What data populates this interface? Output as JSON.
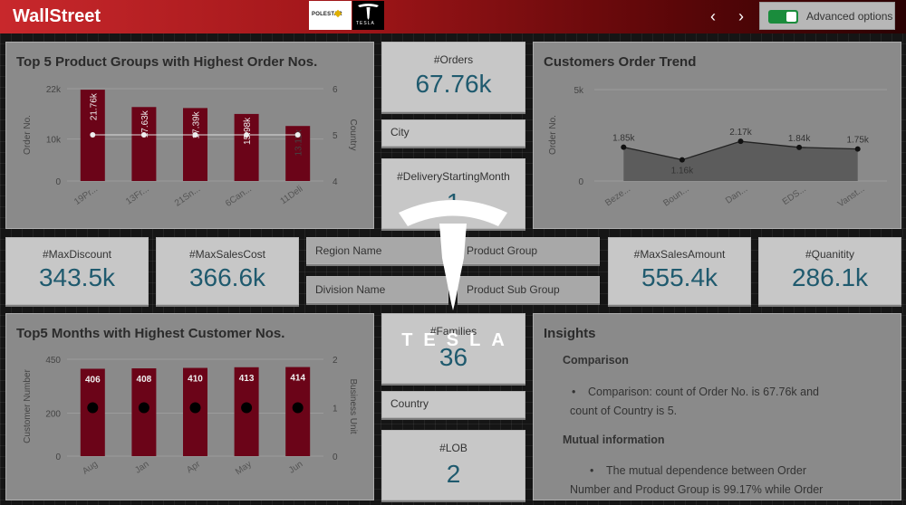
{
  "header": {
    "title": "WallStreet",
    "polestar_logo_text": "POLESTAR",
    "tesla_logo_text": "TESLA",
    "prev_icon": "chevron-left-icon",
    "next_icon": "chevron-right-icon",
    "advanced_label": "Advanced options",
    "toggle_on": true,
    "toggle_color": "#1a8c3c"
  },
  "kpis": {
    "orders": {
      "label": "#Orders",
      "value": "67.76k"
    },
    "delivery_month": {
      "label": "#DeliveryStartingMonth",
      "value": "1"
    },
    "max_discount": {
      "label": "#MaxDiscount",
      "value": "343.5k"
    },
    "max_sales_cost": {
      "label": "#MaxSalesCost",
      "value": "366.6k"
    },
    "max_sales_amount": {
      "label": "#MaxSalesAmount",
      "value": "555.4k"
    },
    "quantity": {
      "label": "#Quanitity",
      "value": "286.1k"
    },
    "families": {
      "label": "#Families",
      "value": "36"
    },
    "lob": {
      "label": "#LOB",
      "value": "2"
    }
  },
  "filters": {
    "city": "City",
    "region": "Region Name",
    "division": "Division Name",
    "product_group": "Product Group",
    "product_sub_group": "Product Sub Group",
    "country": "Country"
  },
  "watermark": {
    "text": "TESLA",
    "logo_icon": "tesla-logo-icon"
  },
  "colors": {
    "bar": "#6b0418",
    "accent": "#1f5a6e",
    "header_start": "#c8282c"
  },
  "chart_data": [
    {
      "id": "top_product_groups",
      "type": "bar",
      "title": "Top 5 Product Groups with Highest Order Nos.",
      "categories": [
        "19Pr...",
        "13Fr...",
        "21Sn...",
        "6Can...",
        "11Deli"
      ],
      "series": [
        {
          "name": "Order No.",
          "values": [
            21760,
            17630,
            17390,
            15980,
            13110
          ],
          "labels": [
            "21.76k",
            "17.63k",
            "17.39k",
            "15.98k",
            "13.11k"
          ],
          "axis": "left"
        },
        {
          "name": "Country",
          "values": [
            5,
            5,
            5,
            5,
            5
          ],
          "axis": "right",
          "style": "line"
        }
      ],
      "ylabel": "Order No.",
      "y2label": "Country",
      "ylim": [
        0,
        22000
      ],
      "y2lim": [
        4,
        6
      ],
      "yticks": [
        "0",
        "10k",
        "22k"
      ],
      "y2ticks": [
        "4",
        "5",
        "6"
      ]
    },
    {
      "id": "customer_order_trend",
      "type": "area",
      "title": "Customers Order Trend",
      "categories": [
        "Beze...",
        "Boun...",
        "Dan...",
        "EDS...",
        "Vanst..."
      ],
      "values": [
        1850,
        1160,
        2170,
        1840,
        1750
      ],
      "labels": [
        "1.85k",
        "1.16k",
        "2.17k",
        "1.84k",
        "1.75k"
      ],
      "ylabel": "Order No.",
      "ylim": [
        0,
        5000
      ],
      "yticks": [
        "0",
        "5k"
      ]
    },
    {
      "id": "top_months",
      "type": "bar",
      "title": "Top5 Months with Highest Customer Nos.",
      "categories": [
        "Aug",
        "Jan",
        "Apr",
        "May",
        "Jun"
      ],
      "series": [
        {
          "name": "Customer Number",
          "values": [
            406,
            408,
            410,
            413,
            414
          ],
          "axis": "left"
        },
        {
          "name": "Business Unit",
          "values": [
            1,
            1,
            1,
            1,
            1
          ],
          "axis": "right",
          "style": "points"
        }
      ],
      "ylabel": "Customer Number",
      "y2label": "Business Unit",
      "ylim": [
        0,
        450
      ],
      "y2lim": [
        0,
        2
      ],
      "yticks": [
        "0",
        "200",
        "450"
      ],
      "y2ticks": [
        "0",
        "1",
        "2"
      ]
    }
  ],
  "insights": {
    "title": "Insights",
    "section1": "Comparison",
    "bullet1_line1": "Comparison: count of Order No. is 67.76k and",
    "bullet1_line2": "count of Country is 5.",
    "section2": "Mutual information",
    "bullet2_line1": "The mutual dependence between Order",
    "bullet2_line2": "Number and Product Group is 99.17% while Order"
  }
}
